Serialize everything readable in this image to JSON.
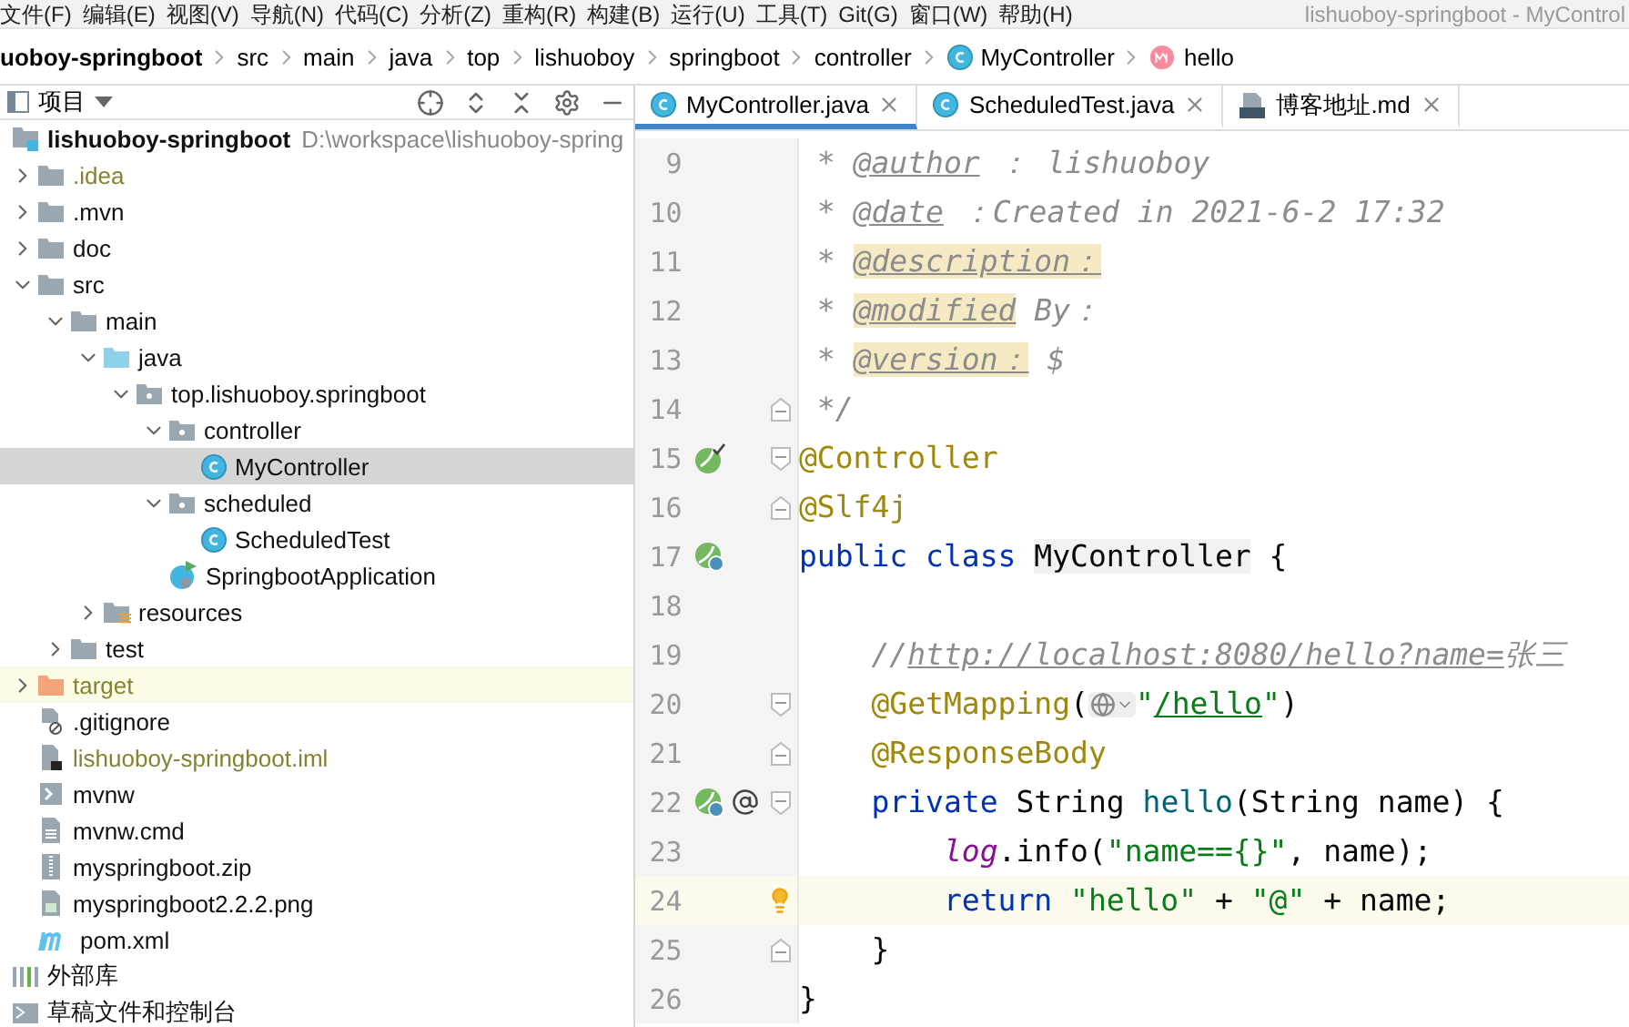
{
  "window": {
    "title": "lishuoboy-springboot - MyControl"
  },
  "menu": [
    "文件(F)",
    "编辑(E)",
    "视图(V)",
    "导航(N)",
    "代码(C)",
    "分析(Z)",
    "重构(R)",
    "构建(B)",
    "运行(U)",
    "工具(T)",
    "Git(G)",
    "窗口(W)",
    "帮助(H)"
  ],
  "breadcrumbs": [
    {
      "label": "uoboy-springboot",
      "kind": "project"
    },
    {
      "label": "src",
      "kind": "folder"
    },
    {
      "label": "main",
      "kind": "folder"
    },
    {
      "label": "java",
      "kind": "folder"
    },
    {
      "label": "top",
      "kind": "folder"
    },
    {
      "label": "lishuoboy",
      "kind": "folder"
    },
    {
      "label": "springboot",
      "kind": "folder"
    },
    {
      "label": "controller",
      "kind": "folder"
    },
    {
      "label": "MyController",
      "kind": "class"
    },
    {
      "label": "hello",
      "kind": "method"
    }
  ],
  "project_panel": {
    "title": "项目",
    "tree": [
      {
        "label": "lishuoboy-springboot",
        "kind": "module",
        "path": "D:\\workspace\\lishuoboy-spring",
        "selected": false,
        "children": [
          {
            "label": ".idea",
            "kind": "folder",
            "expanded": false,
            "ignored": true,
            "selected": false
          },
          {
            "label": ".mvn",
            "kind": "folder",
            "expanded": false,
            "selected": false
          },
          {
            "label": "doc",
            "kind": "folder",
            "expanded": false,
            "selected": false
          },
          {
            "label": "src",
            "kind": "folder",
            "expanded": true,
            "selected": false,
            "children": [
              {
                "label": "main",
                "kind": "folder",
                "expanded": true,
                "selected": false,
                "children": [
                  {
                    "label": "java",
                    "kind": "source",
                    "expanded": true,
                    "selected": false,
                    "children": [
                      {
                        "label": "top.lishuoboy.springboot",
                        "kind": "package",
                        "expanded": true,
                        "selected": false,
                        "children": [
                          {
                            "label": "controller",
                            "kind": "package",
                            "expanded": true,
                            "selected": false,
                            "children": [
                              {
                                "label": "MyController",
                                "kind": "class",
                                "selected": true
                              }
                            ]
                          },
                          {
                            "label": "scheduled",
                            "kind": "package",
                            "expanded": true,
                            "selected": false,
                            "children": [
                              {
                                "label": "ScheduledTest",
                                "kind": "class",
                                "selected": false
                              }
                            ]
                          },
                          {
                            "label": "SpringbootApplication",
                            "kind": "spring-app",
                            "selected": false
                          }
                        ]
                      }
                    ]
                  },
                  {
                    "label": "resources",
                    "kind": "resources",
                    "expanded": false,
                    "selected": false
                  }
                ]
              },
              {
                "label": "test",
                "kind": "folder",
                "expanded": false,
                "selected": false
              }
            ]
          },
          {
            "label": "target",
            "kind": "excluded",
            "expanded": false,
            "ignored": true,
            "selected": false
          },
          {
            "label": ".gitignore",
            "kind": "gitignore",
            "selected": false
          },
          {
            "label": "lishuoboy-springboot.iml",
            "kind": "iml",
            "ignored": true,
            "selected": false
          },
          {
            "label": "mvnw",
            "kind": "script",
            "selected": false
          },
          {
            "label": "mvnw.cmd",
            "kind": "text",
            "selected": false
          },
          {
            "label": "myspringboot.zip",
            "kind": "zip",
            "selected": false
          },
          {
            "label": "myspringboot2.2.2.png",
            "kind": "image",
            "selected": false
          },
          {
            "label": "pom.xml",
            "kind": "maven",
            "selected": false
          }
        ]
      },
      {
        "label": "外部库",
        "kind": "library",
        "selected": false
      },
      {
        "label": "草稿文件和控制台",
        "kind": "scratches",
        "selected": false
      }
    ]
  },
  "tabs": [
    {
      "label": "MyController.java",
      "kind": "class",
      "selected": true
    },
    {
      "label": "ScheduledTest.java",
      "kind": "class",
      "selected": false
    },
    {
      "label": "博客地址.md",
      "kind": "markdown",
      "selected": false
    }
  ],
  "editor": {
    "lines": [
      {
        "number": "9",
        "tokens": [
          {
            "text": " * ",
            "kind": "comment"
          },
          {
            "text": "@author",
            "kind": "doctag"
          },
          {
            "text": " ： lishuoboy",
            "kind": "comment"
          }
        ]
      },
      {
        "number": "10",
        "tokens": [
          {
            "text": " * ",
            "kind": "comment"
          },
          {
            "text": "@date",
            "kind": "doctag"
          },
          {
            "text": " ：Created in 2021-6-2 17:32",
            "kind": "comment"
          }
        ]
      },
      {
        "number": "11",
        "tokens": [
          {
            "text": " * ",
            "kind": "comment"
          },
          {
            "text": "@description：",
            "kind": "doctag-hl"
          }
        ]
      },
      {
        "number": "12",
        "tokens": [
          {
            "text": " * ",
            "kind": "comment"
          },
          {
            "text": "@modified",
            "kind": "doctag-hl"
          },
          {
            "text": " By：",
            "kind": "comment"
          }
        ]
      },
      {
        "number": "13",
        "tokens": [
          {
            "text": " * ",
            "kind": "comment"
          },
          {
            "text": "@version：",
            "kind": "doctag-hl"
          },
          {
            "text": " $",
            "kind": "comment"
          }
        ]
      },
      {
        "number": "14",
        "fold": {
          "kind": "end"
        },
        "tokens": [
          {
            "text": " */",
            "kind": "comment"
          }
        ]
      },
      {
        "number": "15",
        "fold": {
          "kind": "start"
        },
        "icons": [
          {
            "kind": "bean-check"
          }
        ],
        "tokens": [
          {
            "text": "@Controller",
            "kind": "annotation"
          }
        ]
      },
      {
        "number": "16",
        "fold": {
          "kind": "end"
        },
        "tokens": [
          {
            "text": "@Slf4j",
            "kind": "annotation"
          }
        ]
      },
      {
        "number": "17",
        "icons": [
          {
            "kind": "bean-web"
          }
        ],
        "tokens": [
          {
            "text": "public ",
            "kind": "keyword"
          },
          {
            "text": "class ",
            "kind": "keyword"
          },
          {
            "text": "MyController",
            "kind": "ident"
          },
          {
            "text": " {",
            "kind": "plain"
          }
        ]
      },
      {
        "number": "18"
      },
      {
        "number": "19",
        "tokens": [
          {
            "text": "    //",
            "kind": "comment"
          },
          {
            "text": "http://localhost:8080/hello?name=",
            "kind": "url"
          },
          {
            "text": "张三",
            "kind": "comment"
          }
        ]
      },
      {
        "number": "20",
        "fold": {
          "kind": "start"
        },
        "tokens": [
          {
            "text": "    @GetMapping",
            "kind": "annotation"
          },
          {
            "text": "(",
            "kind": "plain"
          },
          {
            "kind": "inlay"
          },
          {
            "text": "\"",
            "kind": "string"
          },
          {
            "text": "/hello",
            "kind": "link-string"
          },
          {
            "text": "\"",
            "kind": "string"
          },
          {
            "text": ")",
            "kind": "plain"
          }
        ]
      },
      {
        "number": "21",
        "fold": {
          "kind": "end"
        },
        "tokens": [
          {
            "text": "    @ResponseBody",
            "kind": "annotation"
          }
        ]
      },
      {
        "number": "22",
        "fold": {
          "kind": "start"
        },
        "icons": [
          {
            "kind": "bean-web"
          },
          {
            "kind": "at"
          }
        ],
        "tokens": [
          {
            "text": "    private",
            "kind": "keyword"
          },
          {
            "text": " String ",
            "kind": "plain"
          },
          {
            "text": "hello",
            "kind": "method"
          },
          {
            "text": "(String name) {",
            "kind": "plain"
          }
        ]
      },
      {
        "number": "23",
        "tokens": [
          {
            "text": "        log",
            "kind": "field"
          },
          {
            "text": ".info(",
            "kind": "plain"
          },
          {
            "text": "\"name=={}\"",
            "kind": "string"
          },
          {
            "text": ", name);",
            "kind": "plain"
          }
        ]
      },
      {
        "number": "24",
        "current": true,
        "bulb": true,
        "tokens": [
          {
            "text": "        return ",
            "kind": "keyword"
          },
          {
            "text": "\"hello\"",
            "kind": "string"
          },
          {
            "text": " + ",
            "kind": "plain"
          },
          {
            "text": "\"@\"",
            "kind": "string"
          },
          {
            "text": " + name;",
            "kind": "plain"
          }
        ]
      },
      {
        "number": "25",
        "fold": {
          "kind": "end"
        },
        "tokens": [
          {
            "text": "    }",
            "kind": "plain"
          }
        ]
      },
      {
        "number": "26",
        "tokens": [
          {
            "text": "}",
            "kind": "plain"
          }
        ]
      }
    ]
  }
}
